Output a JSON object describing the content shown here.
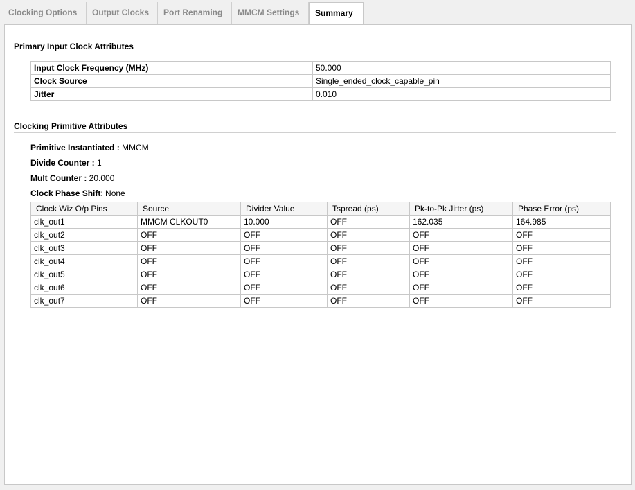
{
  "tabs": [
    {
      "label": "Clocking Options",
      "active": false
    },
    {
      "label": "Output Clocks",
      "active": false
    },
    {
      "label": "Port Renaming",
      "active": false
    },
    {
      "label": "MMCM Settings",
      "active": false
    },
    {
      "label": "Summary",
      "active": true
    }
  ],
  "primary": {
    "title": "Primary Input Clock Attributes",
    "rows": [
      {
        "label": "Input Clock Frequency (MHz)",
        "value": "50.000"
      },
      {
        "label": "Clock Source",
        "value": "Single_ended_clock_capable_pin"
      },
      {
        "label": "Jitter",
        "value": "0.010"
      }
    ]
  },
  "primitive": {
    "title": "Clocking Primitive Attributes",
    "lines": [
      {
        "label": "Primitive Instantiated :",
        "value": "MMCM"
      },
      {
        "label": "Divide Counter :",
        "value": "1"
      },
      {
        "label": "Mult Counter :",
        "value": "20.000"
      },
      {
        "label": "Clock Phase Shift",
        "value": ": None"
      }
    ],
    "table": {
      "headers": [
        "Clock Wiz O/p Pins",
        "Source",
        "Divider Value",
        "Tspread (ps)",
        "Pk-to-Pk Jitter (ps)",
        "Phase Error (ps)"
      ],
      "rows": [
        [
          "clk_out1",
          "MMCM CLKOUT0",
          "10.000",
          "OFF",
          "162.035",
          "164.985"
        ],
        [
          "clk_out2",
          "OFF",
          "OFF",
          "OFF",
          "OFF",
          "OFF"
        ],
        [
          "clk_out3",
          "OFF",
          "OFF",
          "OFF",
          "OFF",
          "OFF"
        ],
        [
          "clk_out4",
          "OFF",
          "OFF",
          "OFF",
          "OFF",
          "OFF"
        ],
        [
          "clk_out5",
          "OFF",
          "OFF",
          "OFF",
          "OFF",
          "OFF"
        ],
        [
          "clk_out6",
          "OFF",
          "OFF",
          "OFF",
          "OFF",
          "OFF"
        ],
        [
          "clk_out7",
          "OFF",
          "OFF",
          "OFF",
          "OFF",
          "OFF"
        ]
      ]
    }
  }
}
